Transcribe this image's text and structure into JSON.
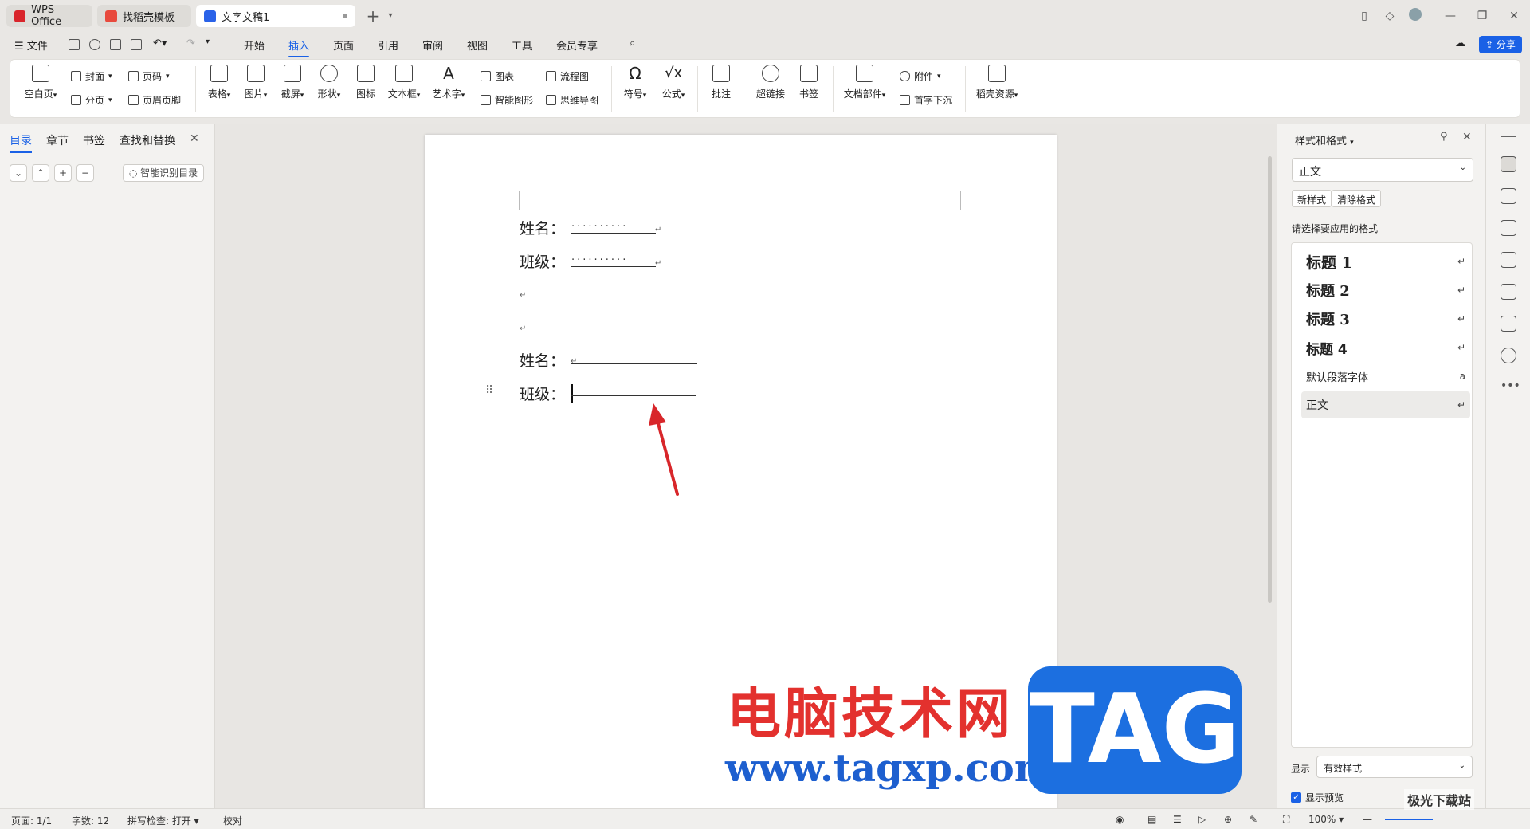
{
  "tabs": [
    {
      "label": "WPS Office",
      "icon": "wps-logo-icon",
      "color": "#d9252b"
    },
    {
      "label": "找稻壳模板",
      "icon": "docer-logo-icon",
      "color": "#e84a3d"
    },
    {
      "label": "文字文稿1",
      "icon": "writer-logo-icon",
      "color": "#2a62e8",
      "active": true
    }
  ],
  "menu": {
    "file": "文件",
    "items": [
      "开始",
      "插入",
      "页面",
      "引用",
      "审阅",
      "视图",
      "工具",
      "会员专享"
    ],
    "active": "插入",
    "share": "分享"
  },
  "ribbon": {
    "blank_page": "空白页",
    "cover": "封面",
    "page_break": "分页",
    "page_number": "页码",
    "header_footer": "页眉页脚",
    "table": "表格",
    "picture": "图片",
    "screenshot": "截屏",
    "shape": "形状",
    "icon": "图标",
    "textbox": "文本框",
    "wordart": "艺术字",
    "chart": "图表",
    "smart_graphic": "智能图形",
    "flowchart": "流程图",
    "mindmap": "思维导图",
    "symbol": "符号",
    "formula": "公式",
    "comment": "批注",
    "hyperlink": "超链接",
    "bookmark": "书签",
    "doc_parts": "文档部件",
    "attachment": "附件",
    "drop_cap": "首字下沉",
    "docer_resources": "稻壳资源"
  },
  "leftpanel": {
    "tabs": [
      "目录",
      "章节",
      "书签",
      "查找和替换"
    ],
    "smart_toc": "智能识别目录"
  },
  "document": {
    "line1_label": "姓名：",
    "line1_dots": "··········",
    "line2_label": "班级：",
    "line2_dots": "··········",
    "line5_label": "姓名：",
    "line6_label": "班级：",
    "para_mark": "↵"
  },
  "rightpanel": {
    "title": "样式和格式",
    "current_style": "正文",
    "new_style": "新样式",
    "clear_format": "清除格式",
    "prompt": "请选择要应用的格式",
    "styles": [
      {
        "label": "标题  1",
        "bold": true,
        "mark": "↵"
      },
      {
        "label": "标题  2",
        "bold": true,
        "mark": "↵"
      },
      {
        "label": "标题  3",
        "bold": true,
        "mark": "↵"
      },
      {
        "label": "标题  4",
        "bold": true,
        "mark": "↵"
      },
      {
        "label": "默认段落字体",
        "bold": false,
        "mark": "a"
      },
      {
        "label": "正文",
        "bold": false,
        "mark": "↵",
        "selected": true
      }
    ],
    "show_label": "显示",
    "show_value": "有效样式",
    "preview_label": "显示预览"
  },
  "statusbar": {
    "page": "页面: 1/1",
    "words": "字数: 12",
    "spell": "拼写检查: 打开",
    "proof": "校对",
    "zoom": "100%"
  },
  "watermark": {
    "cn": "电脑技术网",
    "url": "www.tagxp.com",
    "tag": "TAG",
    "corner": "极光下载站"
  }
}
